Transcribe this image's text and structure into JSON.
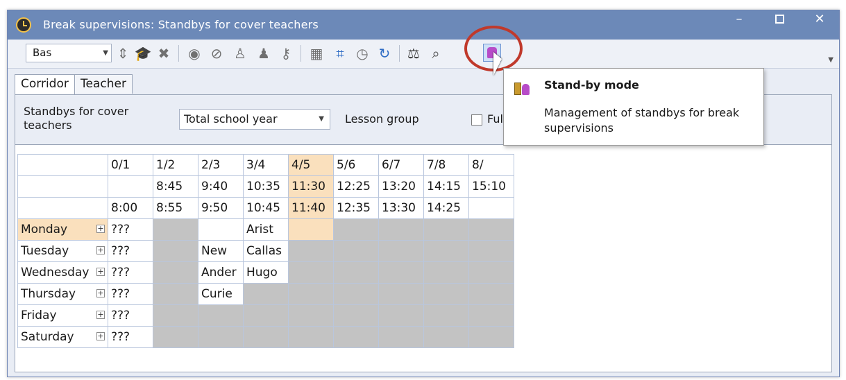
{
  "window": {
    "title": "Break supervisions: Standbys for cover teachers",
    "icon": "clock-icon",
    "controls": {
      "minimize": "–",
      "maximize": "",
      "close": "✕"
    }
  },
  "toolbar": {
    "class_combo_value": "Bas",
    "icons": [
      "spin-up-down-icon",
      "graduation-cap-icon",
      "delete-x-icon",
      "eye-icon",
      "eye-crossed-icon",
      "teacher-stack-icon",
      "teacher-plant-icon",
      "key-teacher-icon",
      "calculator-icon",
      "crop-icon",
      "clock-icon",
      "refresh-icon",
      "scales-icon",
      "zoom-doc-icon",
      "standby-mode-icon"
    ]
  },
  "tabs": [
    "Corridor",
    "Teacher"
  ],
  "filter": {
    "label": "Standbys for cover teachers",
    "period_value": "Total school year",
    "lesson_group_label": "Lesson group",
    "full_label": "Full"
  },
  "grid": {
    "slot_labels": [
      "0/1",
      "1/2",
      "2/3",
      "3/4",
      "4/5",
      "5/6",
      "6/7",
      "7/8",
      "8/"
    ],
    "start_times": [
      "",
      "8:45",
      "9:40",
      "10:35",
      "11:30",
      "12:25",
      "13:20",
      "14:15",
      "15:10"
    ],
    "end_times": [
      "8:00",
      "8:55",
      "9:50",
      "10:45",
      "11:40",
      "12:35",
      "13:30",
      "14:25",
      ""
    ],
    "highlight_column": 4,
    "days": [
      {
        "name": "Monday",
        "cells": [
          "???",
          "",
          "",
          "Arist",
          "",
          "",
          "",
          "",
          ""
        ]
      },
      {
        "name": "Tuesday",
        "cells": [
          "???",
          "",
          "New",
          "Callas",
          "",
          "",
          "",
          "",
          ""
        ]
      },
      {
        "name": "Wednesday",
        "cells": [
          "???",
          "",
          "Ander",
          "Hugo",
          "",
          "",
          "",
          "",
          ""
        ]
      },
      {
        "name": "Thursday",
        "cells": [
          "???",
          "",
          "Curie",
          "",
          "",
          "",
          "",
          "",
          ""
        ]
      },
      {
        "name": "Friday",
        "cells": [
          "???",
          "",
          "",
          "",
          "",
          "",
          "",
          "",
          ""
        ]
      },
      {
        "name": "Saturday",
        "cells": [
          "???",
          "",
          "",
          "",
          "",
          "",
          "",
          "",
          ""
        ]
      }
    ]
  },
  "tooltip": {
    "title": "Stand-by mode",
    "description": "Management of standbys for break supervisions"
  },
  "colors": {
    "titlebar": "#6c89b8",
    "highlight_column": "#fae0bd",
    "blocked_cell": "#c3c3c3",
    "annotation_ring": "#c0392b"
  }
}
